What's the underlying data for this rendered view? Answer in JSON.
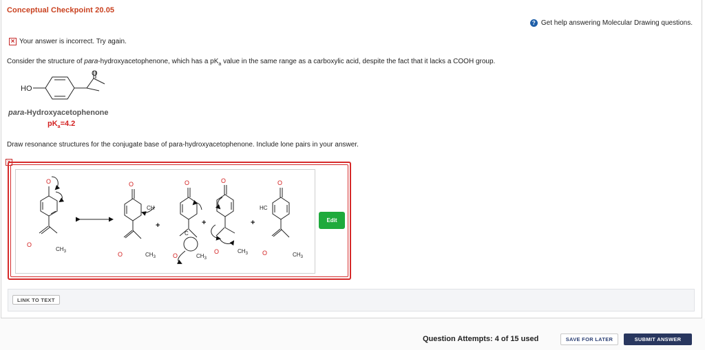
{
  "header": {
    "title": "Conceptual Checkpoint 20.05"
  },
  "help": {
    "label": "Get help answering Molecular Drawing questions."
  },
  "feedback": {
    "message": "Your answer is incorrect.  Try again."
  },
  "question": {
    "prefix": "Consider the structure of ",
    "compound_italic": "para",
    "compound_rest": "-hydroxyacetophenone, which has a pK",
    "sub": "a",
    "suffix": " value in the same range as a carboxylic acid, despite the fact that it lacks a COOH group."
  },
  "structure": {
    "ho_label": "HO",
    "o_label": "O",
    "name_italic": "para",
    "name_rest": "-Hydroxyacetophenone",
    "pka_prefix": "pK",
    "pka_sub": "a",
    "pka_value": "=4.2"
  },
  "instruction": "Draw resonance structures for the conjugate base of para-hydroxyacetophenone. Include lone pairs in your answer.",
  "answer": {
    "edit_label": "Edit",
    "labels": {
      "o": "O",
      "ch3": "CH",
      "ch3_sub": "3",
      "ch": "CH",
      "hc": "HC",
      "c": "C",
      "plus": "+"
    }
  },
  "link": {
    "label": "LINK TO TEXT"
  },
  "footer": {
    "attempts": "Question Attempts: 4 of 15 used",
    "save_label": "SAVE FOR LATER",
    "submit_label": "SUBMIT ANSWER"
  }
}
